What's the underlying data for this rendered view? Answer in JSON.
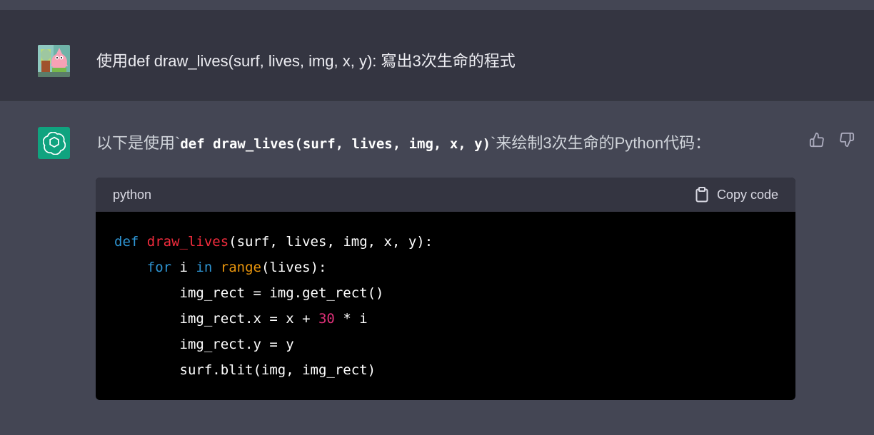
{
  "user_message": {
    "text": "使用def draw_lives(surf, lives, img, x, y): 寫出3次生命的程式"
  },
  "assistant_message": {
    "intro_before": "以下是使用`",
    "intro_code": "def draw_lives(surf, lives, img, x, y)",
    "intro_after": "`来绘制3次生命的Python代码：",
    "feedback": {
      "up_icon": "thumbs-up-icon",
      "down_icon": "thumbs-down-icon"
    }
  },
  "code_block": {
    "language": "python",
    "copy_label": "Copy code",
    "copy_icon": "clipboard-icon",
    "lines": [
      [
        {
          "t": "def",
          "c": "kw"
        },
        {
          "t": " ",
          "c": "plain"
        },
        {
          "t": "draw_lives",
          "c": "fn"
        },
        {
          "t": "(surf, lives, img, x, y):",
          "c": "plain"
        }
      ],
      [
        {
          "t": "    ",
          "c": "plain"
        },
        {
          "t": "for",
          "c": "kw"
        },
        {
          "t": " i ",
          "c": "plain"
        },
        {
          "t": "in",
          "c": "kw"
        },
        {
          "t": " ",
          "c": "plain"
        },
        {
          "t": "range",
          "c": "builtin"
        },
        {
          "t": "(lives):",
          "c": "plain"
        }
      ],
      [
        {
          "t": "        img_rect = img.get_rect()",
          "c": "plain"
        }
      ],
      [
        {
          "t": "        img_rect.x = x + ",
          "c": "plain"
        },
        {
          "t": "30",
          "c": "num"
        },
        {
          "t": " * i",
          "c": "plain"
        }
      ],
      [
        {
          "t": "        img_rect.y = y",
          "c": "plain"
        }
      ],
      [
        {
          "t": "        surf.blit(img, img_rect)",
          "c": "plain"
        }
      ]
    ]
  },
  "colors": {
    "user_bg": "#343541",
    "assistant_bg": "#444654",
    "gpt_brand": "#10a37f",
    "code_bg": "#000000",
    "keyword": "#2e95d3",
    "function": "#f22c3d",
    "builtin": "#e9950c",
    "number": "#df3079"
  }
}
